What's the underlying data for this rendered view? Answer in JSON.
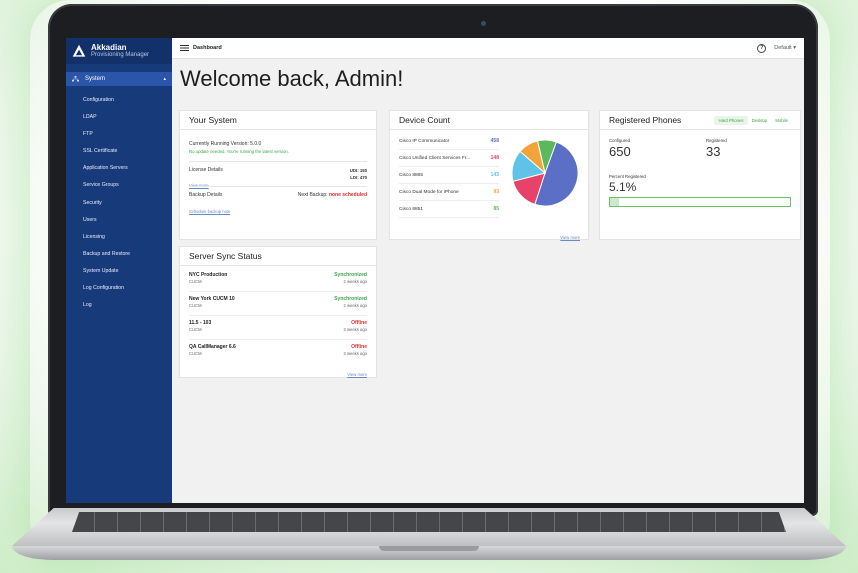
{
  "sidebar": {
    "brand_name": "Akkadian",
    "brand_sub": "Provisioning Manager",
    "section": "System",
    "items": [
      {
        "label": "Configuration"
      },
      {
        "label": "LDAP"
      },
      {
        "label": "FTP"
      },
      {
        "label": "SSL Certificate"
      },
      {
        "label": "Application Servers"
      },
      {
        "label": "Service Groups"
      },
      {
        "label": "Security"
      },
      {
        "label": "Users"
      },
      {
        "label": "Licensing"
      },
      {
        "label": "Backup and Restore"
      },
      {
        "label": "System Update"
      },
      {
        "label": "Log Configuration"
      },
      {
        "label": "Log"
      }
    ]
  },
  "topbar": {
    "breadcrumb": "Dashboard",
    "help": "?",
    "profile": "Default ▾"
  },
  "page_title": "Welcome back, Admin!",
  "your_system": {
    "title": "Your System",
    "version": "Currently Running Version: 5.0.0",
    "version_note": "No update needed. You're running the latest version.",
    "license_label": "License Details",
    "license_link": "View more",
    "udi": "UDI: 150",
    "ldi": "LDI: 470",
    "backup_label": "Backup Details",
    "backup_link": "Schedule backup now",
    "next_backup_label": "Next Backup:",
    "next_backup_value": "none scheduled"
  },
  "device_count": {
    "title": "Device Count",
    "view_more": "View more",
    "items": [
      {
        "label": "Cisco IP Communicator",
        "value": "458",
        "color": "#5b6fc6"
      },
      {
        "label": "Cisco Unified Client Services Fr...",
        "value": "148",
        "color": "#e8416a"
      },
      {
        "label": "Cisco 8865",
        "value": "143",
        "color": "#5ec3e6"
      },
      {
        "label": "Cisco Dual Mode for iPhone",
        "value": "93",
        "color": "#f2a33a"
      },
      {
        "label": "Cisco 8851",
        "value": "85",
        "color": "#5cb85c"
      }
    ]
  },
  "registered_phones": {
    "title": "Registered Phones",
    "tabs": [
      "Hard Phones",
      "Desktop",
      "Mobile"
    ],
    "configured_label": "Configured",
    "configured_value": "650",
    "registered_label": "Registered",
    "registered_value": "33",
    "percent_label": "Percent Registered",
    "percent_value": "5.1%",
    "percent_fraction": 0.051
  },
  "server_sync": {
    "title": "Server Sync Status",
    "view_more": "View more",
    "servers": [
      {
        "name": "NYC Production",
        "type": "CUCM",
        "status": "Synchronized",
        "ago": "2 weeks ago",
        "ok": true
      },
      {
        "name": "New York CUCM 10",
        "type": "CUCM",
        "status": "Synchronized",
        "ago": "2 weeks ago",
        "ok": true
      },
      {
        "name": "11.5 - 103",
        "type": "CUCM",
        "status": "Offline",
        "ago": "3 weeks ago",
        "ok": false
      },
      {
        "name": "QA CallManager 6.6",
        "type": "CUCM",
        "status": "Offline",
        "ago": "3 weeks ago",
        "ok": false
      }
    ]
  }
}
